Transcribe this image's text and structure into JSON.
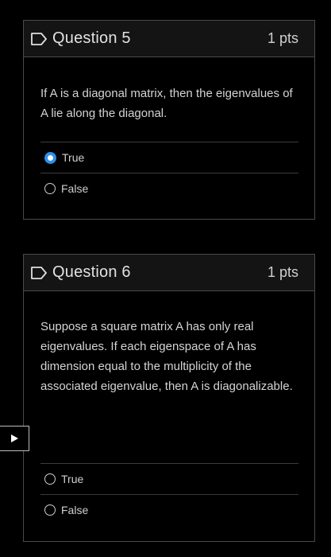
{
  "questions": [
    {
      "title": "Question 5",
      "points": "1 pts",
      "text": "If A is a diagonal matrix, then the eigenvalues of A lie along the diagonal.",
      "options": [
        {
          "label": "True",
          "selected": true
        },
        {
          "label": "False",
          "selected": false
        }
      ]
    },
    {
      "title": "Question 6",
      "points": "1 pts",
      "text": "Suppose a square matrix A has only real eigenvalues. If each eigenspace of A has dimension equal to the multiplicity of the associated eigenvalue, then A is diagonalizable.",
      "options": [
        {
          "label": "True",
          "selected": false
        },
        {
          "label": "False",
          "selected": false
        }
      ]
    }
  ],
  "icons": {
    "flag": "flag-icon",
    "play": "play-icon"
  },
  "colors": {
    "accent": "#2f8fe8",
    "border": "#4a4a4a",
    "background": "#000000"
  }
}
